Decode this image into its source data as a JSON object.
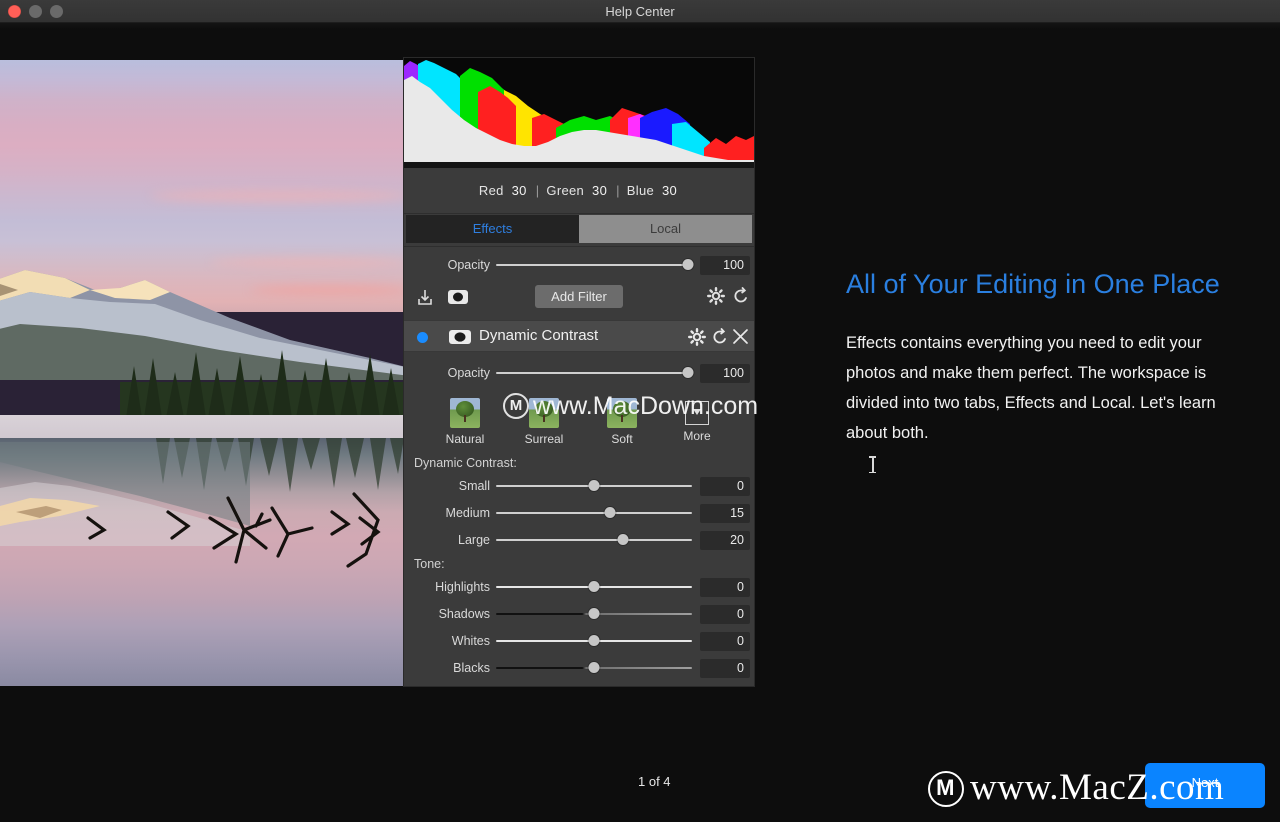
{
  "window": {
    "title": "Help Center",
    "traffic_lights": [
      "close-red",
      "minimize-gray",
      "zoom-gray"
    ]
  },
  "editor_panel": {
    "histogram": {
      "label": "rgb-histogram",
      "readout": {
        "red_label": "Red",
        "red_value": "30",
        "sep1": "|",
        "green_label": "Green",
        "green_value": "30",
        "sep2": "|",
        "blue_label": "Blue",
        "blue_value": "30"
      }
    },
    "tabs": [
      {
        "label": "Effects",
        "active": true
      },
      {
        "label": "Local",
        "active": false
      }
    ],
    "global_opacity": {
      "label": "Opacity",
      "value": "100",
      "percent": 98
    },
    "toolbar": {
      "export_icon": "export-icon",
      "mask_icon": "mask-icon",
      "add_filter_label": "Add Filter",
      "settings_icon": "gear-icon",
      "reset_icon": "reset-icon"
    },
    "filter": {
      "enabled_dot": "enabled-indicator",
      "mask_icon": "mask-icon",
      "name": "Dynamic Contrast",
      "settings_icon": "gear-icon",
      "reset_icon": "reset-icon",
      "close_icon": "close-icon",
      "opacity": {
        "label": "Opacity",
        "value": "100",
        "percent": 98
      },
      "presets": [
        {
          "label": "Natural"
        },
        {
          "label": "Surreal"
        },
        {
          "label": "Soft"
        },
        {
          "label": "More"
        }
      ],
      "groups": [
        {
          "title": "Dynamic Contrast:",
          "sliders": [
            {
              "label": "Small",
              "value": "0",
              "percent": 50,
              "style": "light"
            },
            {
              "label": "Medium",
              "value": "15",
              "percent": 58,
              "style": "light"
            },
            {
              "label": "Large",
              "value": "20",
              "percent": 65,
              "style": "light"
            }
          ]
        },
        {
          "title": "Tone:",
          "sliders": [
            {
              "label": "Highlights",
              "value": "0",
              "percent": 50,
              "style": "white"
            },
            {
              "label": "Shadows",
              "value": "0",
              "percent": 50,
              "style": "dark-left"
            },
            {
              "label": "Whites",
              "value": "0",
              "percent": 50,
              "style": "white"
            },
            {
              "label": "Blacks",
              "value": "0",
              "percent": 50,
              "style": "dark-left"
            }
          ]
        }
      ]
    }
  },
  "tour": {
    "title": "All of Your Editing in One Place",
    "body": "Effects contains everything you need to edit your photos and make them perfect. The workspace is divided into two tabs, Effects and Local. Let's learn about both.",
    "page_indicator": "1 of 4",
    "next_label": "Next"
  },
  "watermarks": {
    "overlay_text": "www.MacDown.com",
    "footer_text": "www.MacZ.com",
    "footer_logo_letter": "M",
    "overlay_logo_letter": "M"
  },
  "colors": {
    "accent_blue": "#2a7fe0",
    "button_blue": "#0a84ff",
    "panel_bg": "#3b3b3b",
    "app_bg": "#0d0d0d"
  }
}
